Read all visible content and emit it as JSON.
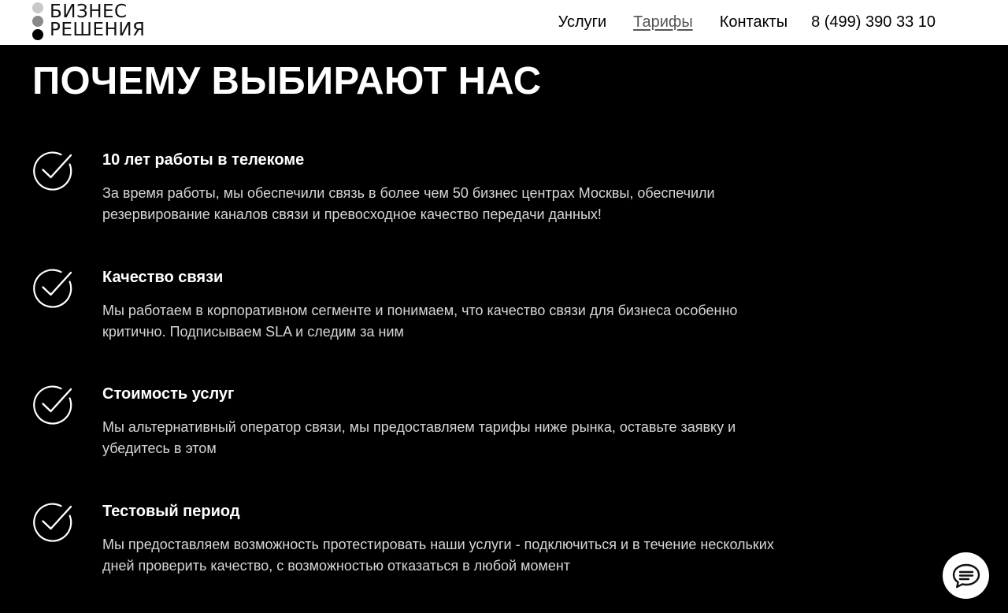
{
  "header": {
    "logo": {
      "line1": "БИЗНЕС",
      "line2": "РЕШЕНИЯ"
    },
    "nav": [
      {
        "label": "Услуги",
        "active": false
      },
      {
        "label": "Тарифы",
        "active": true
      },
      {
        "label": "Контакты",
        "active": false
      }
    ],
    "phone": "8 (499) 390 33 10"
  },
  "section": {
    "title": "ПОЧЕМУ ВЫБИРАЮТ НАС",
    "features": [
      {
        "icon": "check-circle-icon",
        "title": "10 лет работы в телекоме",
        "text": "За время работы, мы обеспечили связь в более чем 50 бизнес центрах Москвы, обеспечили резервирование каналов связи и превосходное качество передачи данных!"
      },
      {
        "icon": "check-circle-icon",
        "title": "Качество связи",
        "text": "Мы работаем в корпоративном сегменте и понимаем, что качество связи для бизнеса особенно критично. Подписываем SLA и следим за ним"
      },
      {
        "icon": "check-circle-icon",
        "title": "Стоимость услуг",
        "text": "Мы альтернативный оператор связи, мы предоставляем тарифы ниже рынка, оставьте заявку и убедитесь в этом"
      },
      {
        "icon": "check-circle-icon",
        "title": "Тестовый период",
        "text": "Мы предоставляем возможность протестировать наши услуги - подключиться и в течение нескольких дней проверить качество, с возможностью отказаться в любой момент"
      }
    ]
  },
  "chat_widget": {
    "icon": "chat-bubble-icon"
  },
  "colors": {
    "background": "#000000",
    "header_background": "#ffffff",
    "text_primary": "#ffffff",
    "text_secondary": "#d6d6d6",
    "nav_active": "#555555"
  }
}
